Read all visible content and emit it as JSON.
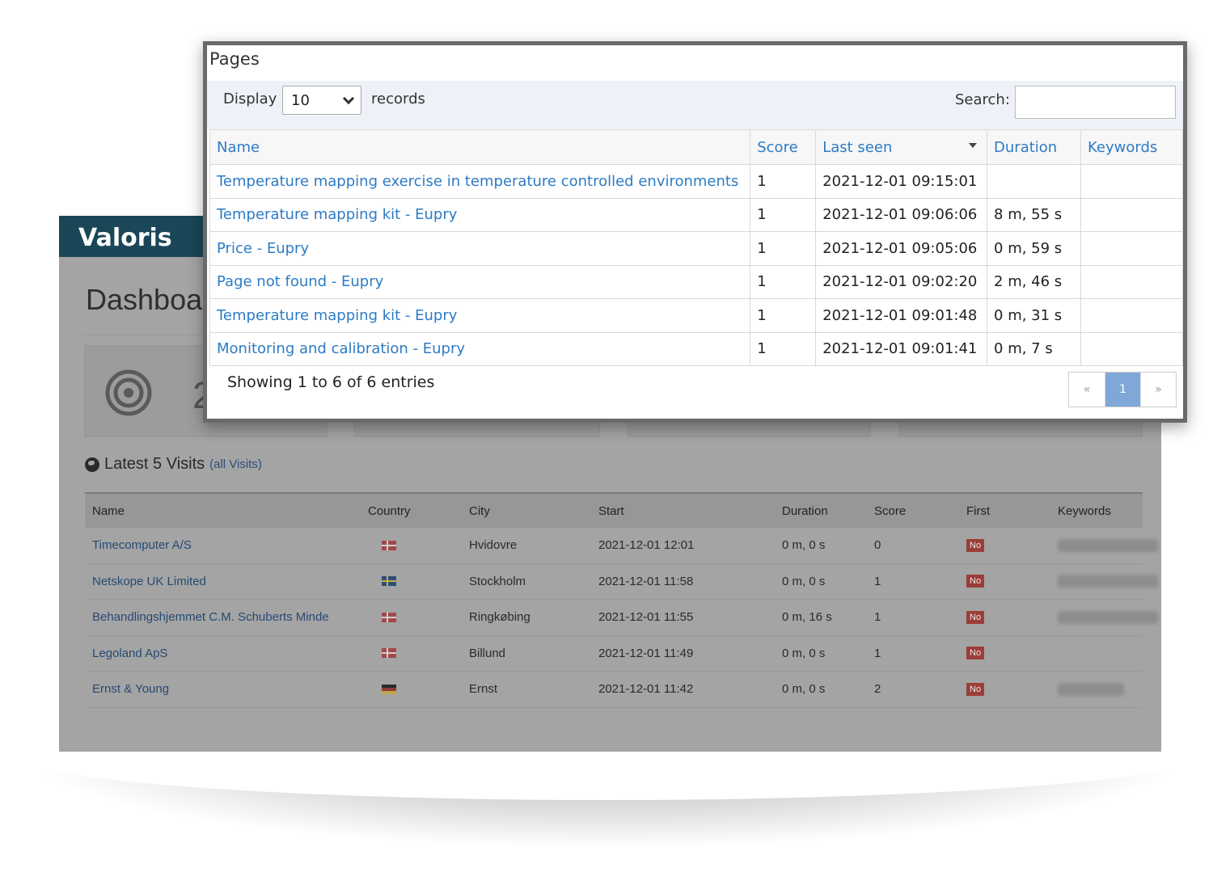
{
  "brand": "Valoris",
  "dashboard": {
    "title": "Dashboa",
    "stat_number": "2",
    "visits": {
      "heading": "Latest 5 Visits",
      "all_link": "(all Visits)",
      "columns": [
        "Name",
        "Country",
        "City",
        "Start",
        "Duration",
        "Score",
        "First",
        "Keywords"
      ],
      "rows": [
        {
          "name": "Timecomputer A/S",
          "country_flag": "dk",
          "city": "Hvidovre",
          "start": "2021-12-01 12:01",
          "duration": "0 m, 0 s",
          "score": "0",
          "first": "No",
          "keywords_blurred": true
        },
        {
          "name": "Netskope UK Limited",
          "country_flag": "se",
          "city": "Stockholm",
          "start": "2021-12-01 11:58",
          "duration": "0 m, 0 s",
          "score": "1",
          "first": "No",
          "keywords_blurred": true
        },
        {
          "name": "Behandlingshjemmet C.M. Schuberts Minde",
          "country_flag": "dk",
          "city": "Ringkøbing",
          "start": "2021-12-01 11:55",
          "duration": "0 m, 16 s",
          "score": "1",
          "first": "No",
          "keywords_blurred": true
        },
        {
          "name": "Legoland ApS",
          "country_flag": "dk",
          "city": "Billund",
          "start": "2021-12-01 11:49",
          "duration": "0 m, 0 s",
          "score": "1",
          "first": "No",
          "keywords_blurred": false
        },
        {
          "name": "Ernst & Young",
          "country_flag": "de",
          "city": "Ernst",
          "start": "2021-12-01 11:42",
          "duration": "0 m, 0 s",
          "score": "2",
          "first": "No",
          "keywords_blurred": true
        }
      ]
    }
  },
  "pages": {
    "title": "Pages",
    "display_label": "Display",
    "records_select_value": "10",
    "records_label": "records",
    "search_label": "Search:",
    "search_value": "",
    "columns": [
      "Name",
      "Score",
      "Last seen",
      "Duration",
      "Keywords"
    ],
    "rows": [
      {
        "name": "Temperature mapping exercise in temperature controlled environments",
        "score": "1",
        "last_seen": "2021-12-01 09:15:01",
        "duration": "",
        "keywords": ""
      },
      {
        "name": "Temperature mapping kit - Eupry",
        "score": "1",
        "last_seen": "2021-12-01 09:06:06",
        "duration": "8 m, 55 s",
        "keywords": ""
      },
      {
        "name": "Price - Eupry",
        "score": "1",
        "last_seen": "2021-12-01 09:05:06",
        "duration": "0 m, 59 s",
        "keywords": ""
      },
      {
        "name": "Page not found - Eupry",
        "score": "1",
        "last_seen": "2021-12-01 09:02:20",
        "duration": "2 m, 46 s",
        "keywords": ""
      },
      {
        "name": "Temperature mapping kit - Eupry",
        "score": "1",
        "last_seen": "2021-12-01 09:01:48",
        "duration": "0 m, 31 s",
        "keywords": ""
      },
      {
        "name": "Monitoring and calibration - Eupry",
        "score": "1",
        "last_seen": "2021-12-01 09:01:41",
        "duration": "0 m, 7 s",
        "keywords": ""
      }
    ],
    "footer_info": "Showing 1 to 6 of 6 entries",
    "pager": {
      "prev": "«",
      "current": "1",
      "next": "»"
    }
  }
}
